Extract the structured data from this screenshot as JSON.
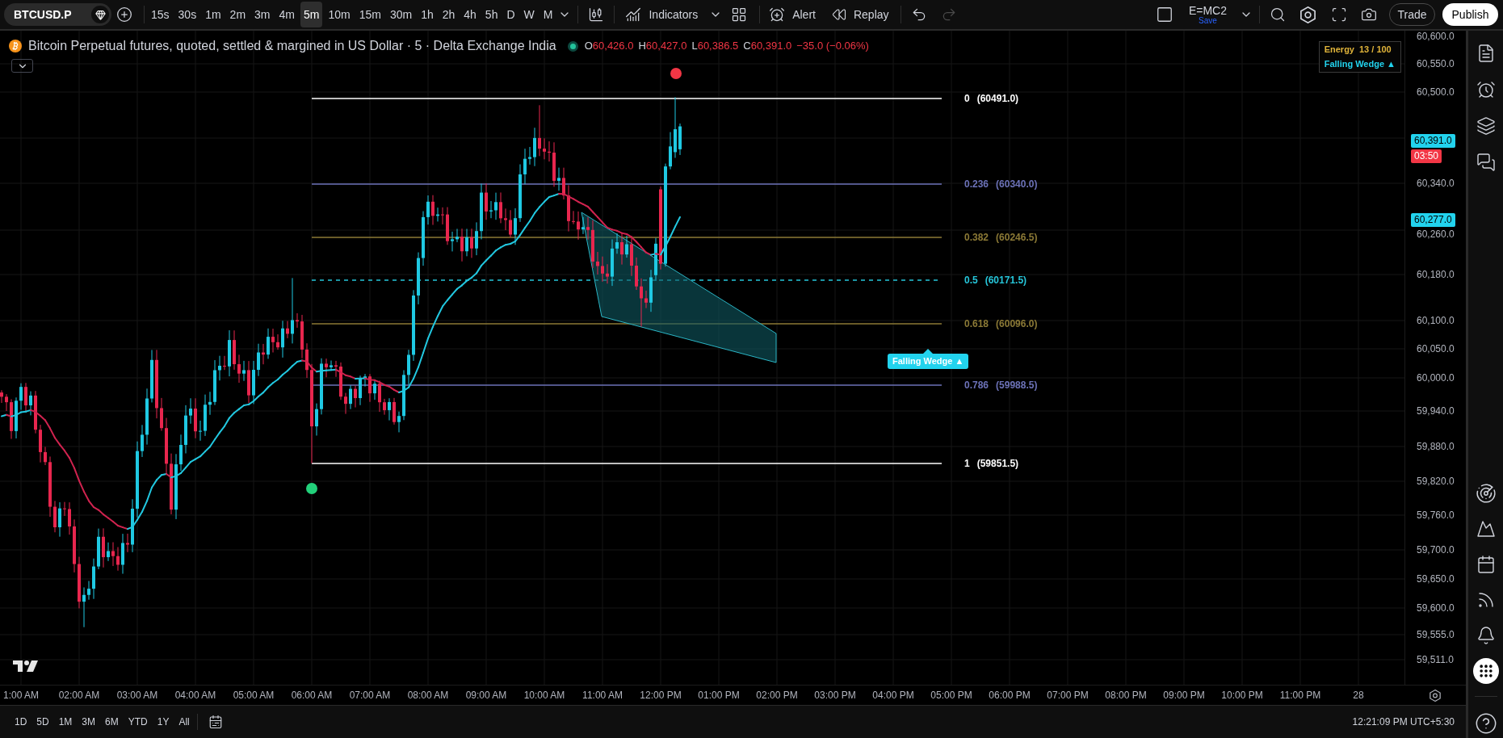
{
  "toolbar": {
    "symbol": "BTCUSD.P",
    "intervals": [
      {
        "label": "15s",
        "selected": false
      },
      {
        "label": "30s",
        "selected": false
      },
      {
        "label": "1m",
        "selected": false
      },
      {
        "label": "2m",
        "selected": false
      },
      {
        "label": "3m",
        "selected": false
      },
      {
        "label": "4m",
        "selected": false
      },
      {
        "label": "5m",
        "selected": true
      },
      {
        "label": "10m",
        "selected": false
      },
      {
        "label": "15m",
        "selected": false
      },
      {
        "label": "30m",
        "selected": false
      },
      {
        "label": "1h",
        "selected": false
      },
      {
        "label": "2h",
        "selected": false
      },
      {
        "label": "4h",
        "selected": false
      },
      {
        "label": "5h",
        "selected": false
      },
      {
        "label": "D",
        "selected": false
      },
      {
        "label": "W",
        "selected": false
      },
      {
        "label": "M",
        "selected": false
      }
    ],
    "indicators": "Indicators",
    "alert": "Alert",
    "replay": "Replay",
    "undo": {
      "disabled": false
    },
    "redo": {
      "disabled": true
    },
    "layout": {
      "name": "E=MC2",
      "status": "Save"
    },
    "trade": "Trade",
    "publish": "Publish"
  },
  "legend": {
    "title": "Bitcoin Perpetual futures, quoted, settled & margined in US Dollar · 5 · Delta Exchange India",
    "negative": true,
    "ohlc": [
      {
        "label": "O",
        "value": "60,426.0"
      },
      {
        "label": "H",
        "value": "60,427.0"
      },
      {
        "label": "L",
        "value": "60,386.5"
      },
      {
        "label": "C",
        "value": "60,391.0"
      }
    ],
    "change": "−35.0 (−0.06%)"
  },
  "indicator_panel": {
    "energy_label": "Energy",
    "energy_value": "13 / 100",
    "pattern": "Falling Wedge ▲"
  },
  "signals": [
    {
      "color": "#f23645"
    },
    {
      "color": "#22d07a"
    }
  ],
  "fib_levels": [
    {
      "level": "0",
      "price": "(60491.0)",
      "color": "#ffffff",
      "kind": "solid"
    },
    {
      "level": "0.236",
      "price": "(60340.0)",
      "color": "#6c72b8",
      "kind": "solid"
    },
    {
      "level": "0.382",
      "price": "(60246.5)",
      "color": "#8c7a36",
      "kind": "solid"
    },
    {
      "level": "0.5",
      "price": "(60171.5)",
      "color": "#26c6da",
      "kind": "dashed"
    },
    {
      "level": "0.618",
      "price": "(60096.0)",
      "color": "#8c7a36",
      "kind": "solid"
    },
    {
      "level": "0.786",
      "price": "(59988.5)",
      "color": "#6c72b8",
      "kind": "solid"
    },
    {
      "level": "1",
      "price": "(59851.5)",
      "color": "#ffffff",
      "kind": "solid"
    }
  ],
  "pattern_label": "Falling Wedge ▲",
  "price_axis": {
    "labels": [
      "60,600.0",
      "60,550.0",
      "60,500.0",
      "60,340.0",
      "60,260.0",
      "60,180.0",
      "60,100.0",
      "60,050.0",
      "60,000.0",
      "59,940.0",
      "59,880.0",
      "59,820.0",
      "59,760.0",
      "59,700.0",
      "59,650.0",
      "59,600.0",
      "59,555.0",
      "59,511.0"
    ],
    "badges": [
      {
        "text": "60,391.0",
        "kind": "price",
        "color": "#22d3ee"
      },
      {
        "text": "03:50",
        "kind": "countdown",
        "color": "#f23645"
      },
      {
        "text": "60,277.0",
        "kind": "price",
        "color": "#22d3ee"
      }
    ]
  },
  "time_axis": {
    "labels": [
      "1:00 AM",
      "02:00 AM",
      "03:00 AM",
      "04:00 AM",
      "05:00 AM",
      "06:00 AM",
      "07:00 AM",
      "08:00 AM",
      "09:00 AM",
      "10:00 AM",
      "11:00 AM",
      "12:00 PM",
      "01:00 PM",
      "02:00 PM",
      "03:00 PM",
      "04:00 PM",
      "05:00 PM",
      "06:00 PM",
      "07:00 PM",
      "08:00 PM",
      "09:00 PM",
      "10:00 PM",
      "11:00 PM",
      "28"
    ]
  },
  "bottom_bar": {
    "ranges": [
      "1D",
      "5D",
      "1M",
      "3M",
      "6M",
      "YTD",
      "1Y",
      "All"
    ],
    "clock": "12:21:09 PM UTC+5:30"
  }
}
